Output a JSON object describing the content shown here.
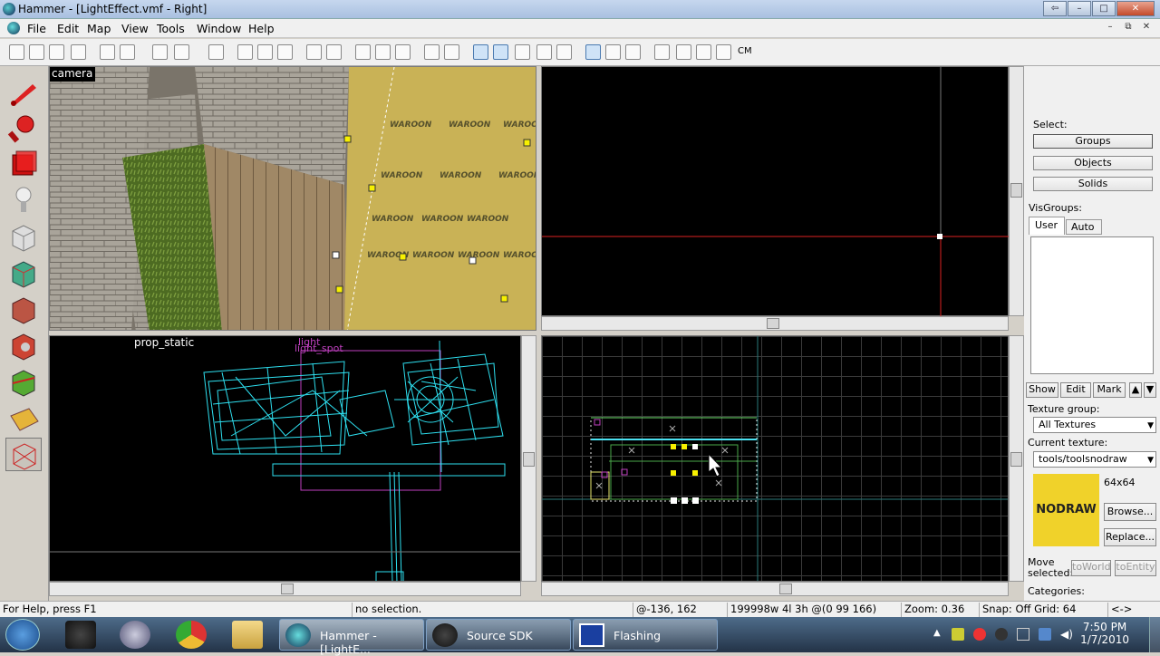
{
  "window": {
    "title": "Hammer - [LightEffect.vmf - Right]"
  },
  "menu": [
    "File",
    "Edit",
    "Map",
    "View",
    "Tools",
    "Window",
    "Help"
  ],
  "toolbar": {
    "cm_label": "CM"
  },
  "viewports": {
    "camera_label": "camera",
    "front_labels": {
      "prop": "prop_static",
      "light": "light",
      "light_spot": "light_spot"
    },
    "texture_text": "WAROON"
  },
  "right_panel": {
    "select_label": "Select:",
    "select_buttons": [
      "Groups",
      "Objects",
      "Solids"
    ],
    "visgroups_label": "VisGroups:",
    "visgroup_tabs": [
      "User",
      "Auto"
    ],
    "vis_buttons": [
      "Show",
      "Edit",
      "Mark"
    ],
    "texture_group_label": "Texture group:",
    "texture_group_value": "All Textures",
    "current_texture_label": "Current texture:",
    "current_texture_value": "tools/toolsnodraw",
    "texture_preview_text": "NODRAW",
    "texture_size": "64x64",
    "browse_label": "Browse...",
    "replace_label": "Replace...",
    "move_selected_label": "Move selected:",
    "to_world": "toWorld",
    "to_entity": "toEntity",
    "categories_label": "Categories:"
  },
  "status": {
    "help": "For Help, press F1",
    "selection": "no selection.",
    "coords": "@-136, 162",
    "size": "199998w 4l 3h @(0 99 166)",
    "zoom": "Zoom: 0.36",
    "snap": "Snap: Off Grid: 64",
    "arrows": "<->"
  },
  "taskbar": {
    "apps": [
      "Hammer - [LightE...",
      "Source SDK",
      "Flashing"
    ],
    "time": "7:50 PM",
    "date": "1/7/2010"
  },
  "colors": {
    "texture_yellow": "#f0d22a",
    "wire_cyan": "#2ee0f0",
    "selection_red": "#e0303a"
  }
}
